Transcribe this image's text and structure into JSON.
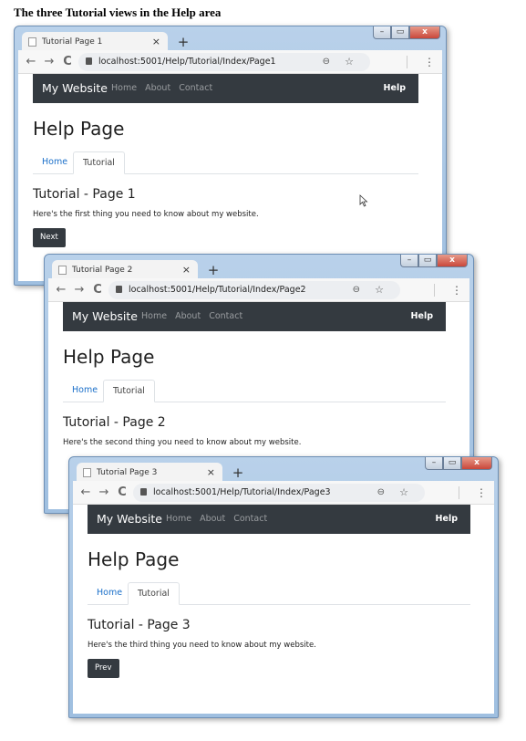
{
  "caption": "The three Tutorial views in the Help area",
  "windows": [
    {
      "tab_title": "Tutorial Page 1",
      "url": "localhost:5001/Help/Tutorial/Index/Page1",
      "brand": "My Website",
      "nav": [
        "Home",
        "About",
        "Contact"
      ],
      "nav_right": "Help",
      "heading": "Help Page",
      "page_tabs": [
        "Home",
        "Tutorial"
      ],
      "subheading": "Tutorial - Page 1",
      "text": "Here's the first thing you need to know about my website.",
      "button": "Next"
    },
    {
      "tab_title": "Tutorial Page 2",
      "url": "localhost:5001/Help/Tutorial/Index/Page2",
      "brand": "My Website",
      "nav": [
        "Home",
        "About",
        "Contact"
      ],
      "nav_right": "Help",
      "heading": "Help Page",
      "page_tabs": [
        "Home",
        "Tutorial"
      ],
      "subheading": "Tutorial - Page 2",
      "text": "Here's the second thing you need to know about my website.",
      "button": ""
    },
    {
      "tab_title": "Tutorial Page 3",
      "url": "localhost:5001/Help/Tutorial/Index/Page3",
      "brand": "My Website",
      "nav": [
        "Home",
        "About",
        "Contact"
      ],
      "nav_right": "Help",
      "heading": "Help Page",
      "page_tabs": [
        "Home",
        "Tutorial"
      ],
      "subheading": "Tutorial - Page 3",
      "text": "Here's the third thing you need to know about my website.",
      "button": "Prev"
    }
  ],
  "icons": {
    "back": "←",
    "forward": "→",
    "reload": "C",
    "new_tab": "+",
    "close": "×",
    "zoom": "⊖",
    "star": "☆",
    "menu": "⋮",
    "minimize": "–",
    "maximize": "▭",
    "close_window": "x"
  }
}
